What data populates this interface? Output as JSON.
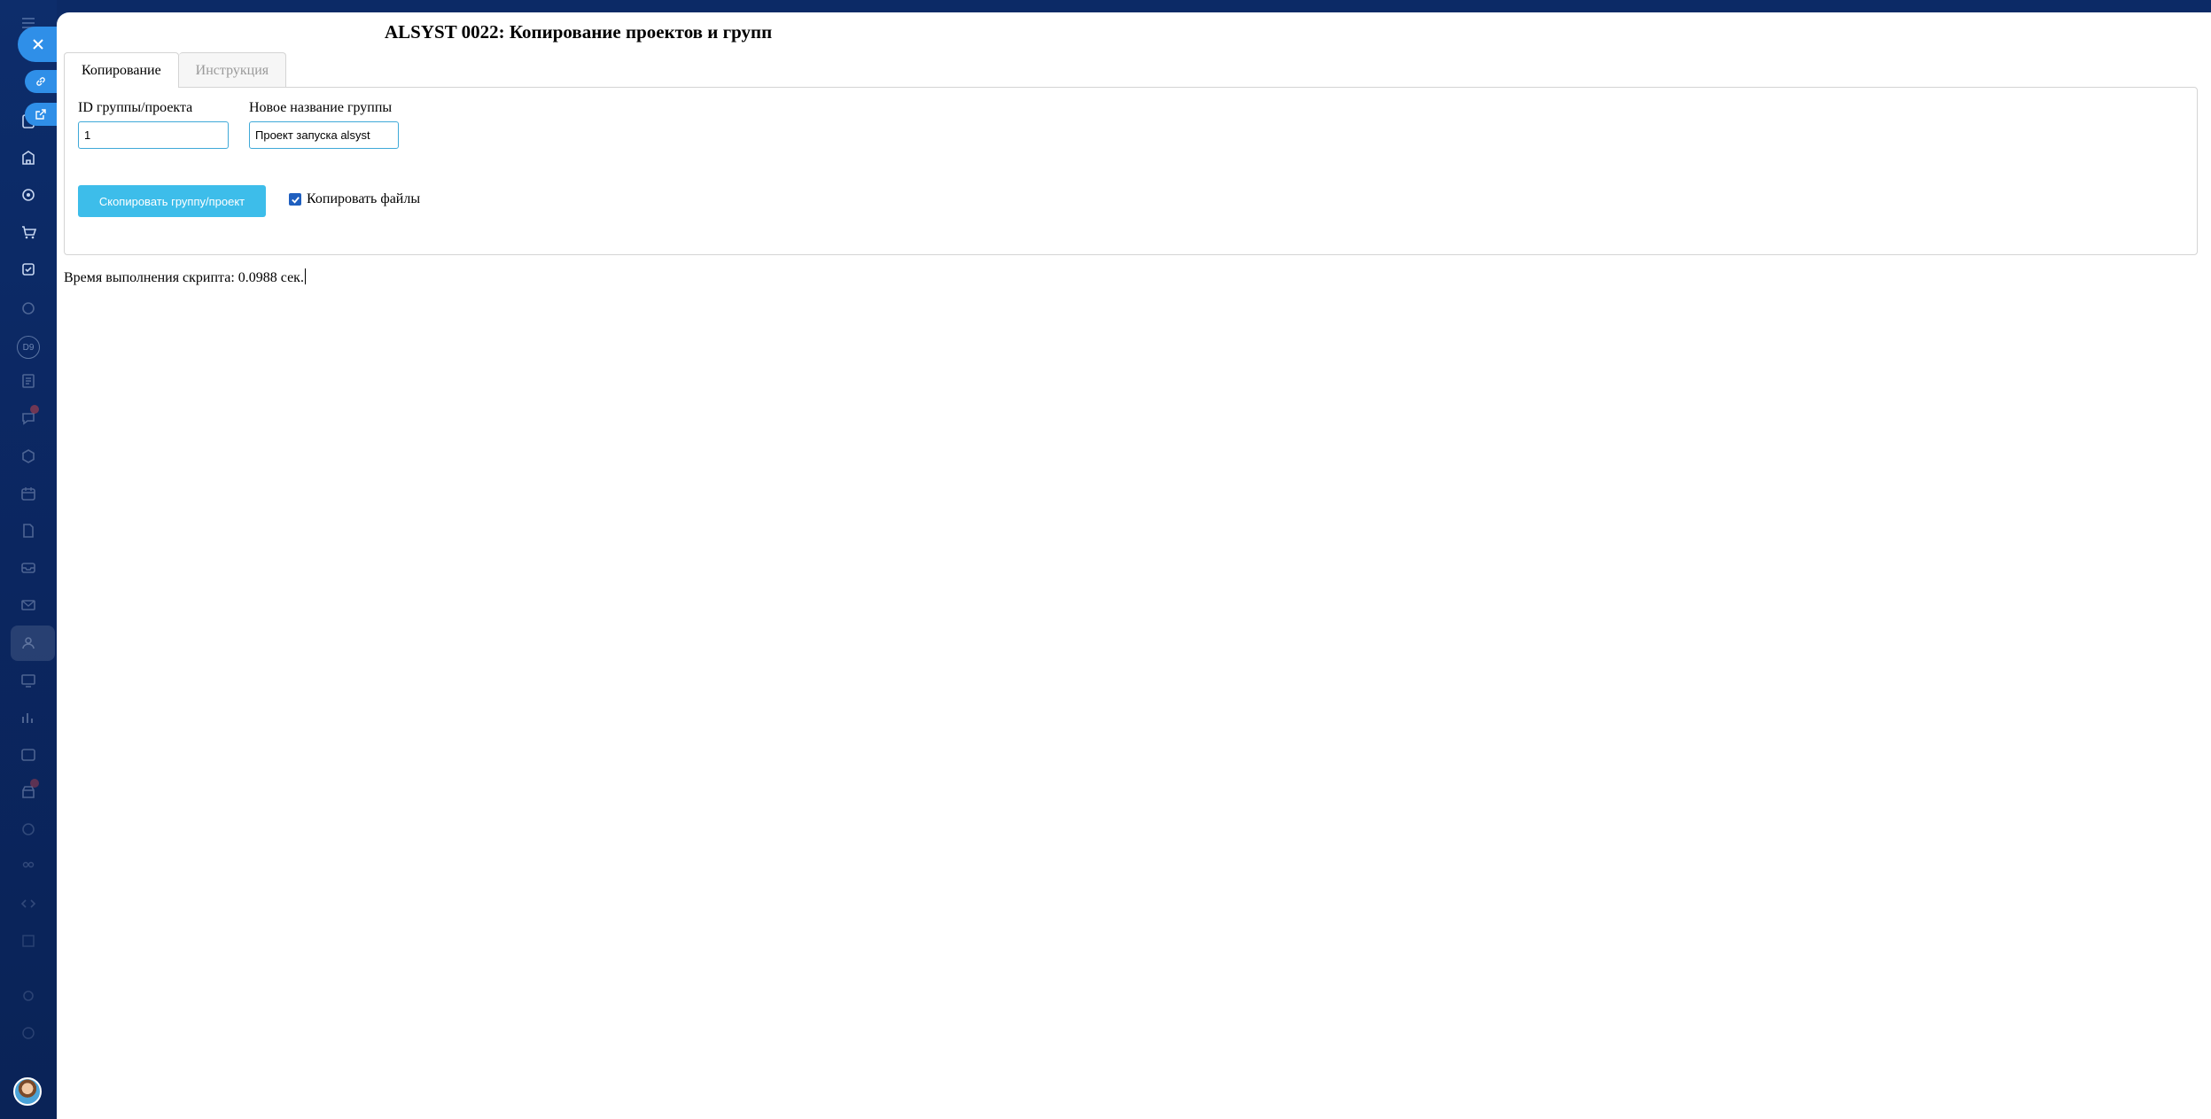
{
  "page": {
    "title": "ALSYST 0022: Копирование проектов и групп"
  },
  "tabs": [
    {
      "label": "Копирование",
      "active": true
    },
    {
      "label": "Инструкция",
      "active": false
    }
  ],
  "form": {
    "group_id": {
      "label": "ID группы/проекта",
      "value": "1"
    },
    "new_name": {
      "label": "Новое название группы",
      "value": "Проект запуска alsyst"
    },
    "copy_button": "Скопировать группу/проект",
    "copy_files": {
      "label": "Копировать файлы",
      "checked": true
    }
  },
  "status": {
    "exec_time": "Время выполнения скрипта: 0.0988 сек."
  },
  "colors": {
    "accent": "#3dbdea",
    "input_border": "#3fa9d8",
    "sidebar": "#0b2660",
    "close_button": "#2f8fe8"
  },
  "icons": {
    "close": "close-icon",
    "link": "link-icon",
    "open_external": "external-link-icon"
  }
}
